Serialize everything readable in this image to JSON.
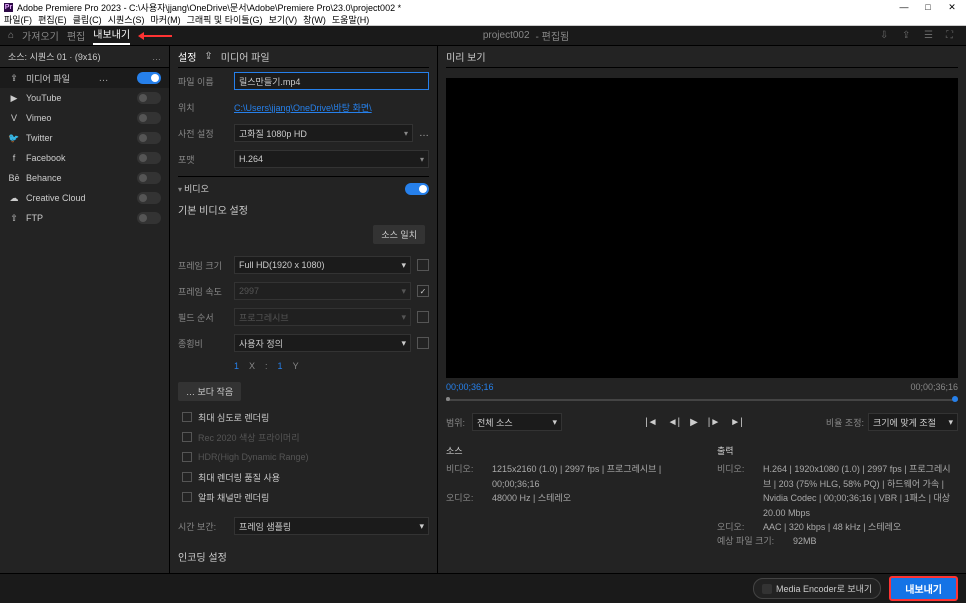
{
  "titlebar": {
    "title": "Adobe Premiere Pro 2023 - C:\\사용자\\jjang\\OneDrive\\문서\\Adobe\\Premiere Pro\\23.0\\project002 *"
  },
  "menubar": [
    "파일(F)",
    "편집(E)",
    "클립(C)",
    "시퀀스(S)",
    "마커(M)",
    "그래픽 및 타이틀(G)",
    "보기(V)",
    "창(W)",
    "도움말(H)"
  ],
  "modebar": {
    "items": [
      "가져오기",
      "편집",
      "내보내기"
    ],
    "active_index": 2,
    "project": "project002",
    "project_status": "- 편집됨"
  },
  "sidebar": {
    "source_label": "소스:",
    "source_value": "시퀀스 01 · (9x16)",
    "dests": [
      {
        "icon": "⇪",
        "label": "미디어 파일",
        "on": true,
        "active": true
      },
      {
        "icon": "▶",
        "label": "YouTube",
        "on": false
      },
      {
        "icon": "V",
        "label": "Vimeo",
        "on": false
      },
      {
        "icon": "🐦",
        "label": "Twitter",
        "on": false
      },
      {
        "icon": "f",
        "label": "Facebook",
        "on": false
      },
      {
        "icon": "Bē",
        "label": "Behance",
        "on": false
      },
      {
        "icon": "☁",
        "label": "Creative Cloud",
        "on": false
      },
      {
        "icon": "⇧",
        "label": "FTP",
        "on": false
      }
    ],
    "three_dots": "…",
    "overflow": "…"
  },
  "settings": {
    "tabs": [
      "설정"
    ],
    "subtab_icon": "⇪",
    "subtab_label": "미디어 파일",
    "filename_label": "파일 이름",
    "filename_value": "릴스만들기.mp4",
    "location_label": "위치",
    "location_value": "C:\\Users\\jjang\\OneDrive\\바탕 화면\\",
    "preset_label": "사전 설정",
    "preset_value": "고화질 1080p HD",
    "format_label": "포맷",
    "format_value": "H.264",
    "three_dots": "…",
    "video_section": "비디오",
    "video_on": true,
    "basic_video_label": "기본 비디오 설정",
    "src_match_btn": "소스 일치",
    "frame_size_label": "프레임 크기",
    "frame_size_value": "Full HD(1920 x 1080)",
    "frame_rate_label": "프레임 속도",
    "frame_rate_value": "2997",
    "field_order_label": "필드 순서",
    "field_order_value": "프로그레시브",
    "aspect_label": "종횡비",
    "aspect_value": "사용자 정의",
    "x_val": "1",
    "y_val": "1",
    "x_lbl": "X",
    "colon": ":",
    "y_lbl": "Y",
    "more_label": "… 보다 작음",
    "chk_max_depth": "최대 심도로 렌더링",
    "chk_rec2020": "Rec 2020 색상 프라이머리",
    "chk_hdr": "HDR(High Dynamic Range)",
    "chk_max_quality": "최대 렌더링 품질 사용",
    "chk_alpha": "알파 채널만 렌더링",
    "time_interp_label": "시간 보간:",
    "time_interp_value": "프레임 샘플링",
    "encoding_label": "인코딩 설정"
  },
  "preview": {
    "header": "미리 보기",
    "tc_left": "00;00;36;16",
    "tc_right": "00;00;36;16",
    "range_label": "범위:",
    "range_value": "전체 소스",
    "scale_label": "비율 조정:",
    "scale_value": "크기에 맞게 조절",
    "transport": [
      "|◄",
      "◄|",
      "▶",
      "|►",
      "►|"
    ],
    "source_hdr": "소스",
    "source_video_k": "비디오:",
    "source_video_v": "1215x2160 (1.0) | 2997 fps | 프로그레시브 | 00;00;36;16",
    "source_audio_k": "오디오:",
    "source_audio_v": "48000 Hz | 스테레오",
    "output_hdr": "출력",
    "output_video_k": "비디오:",
    "output_video_v": "H.264 | 1920x1080 (1.0) | 2997 fps | 프로그레시브 | 203 (75% HLG, 58% PQ) | 하드웨어 가속 | Nvidia Codec | 00;00;36;16 | VBR | 1패스 | 대상 20.00 Mbps",
    "output_audio_k": "오디오:",
    "output_audio_v": "AAC | 320 kbps | 48 kHz | 스테레오",
    "est_size_k": "예상 파일 크기:",
    "est_size_v": "92MB"
  },
  "bottom": {
    "encoder_btn": "Media Encoder로 보내기",
    "export_btn": "내보내기"
  }
}
